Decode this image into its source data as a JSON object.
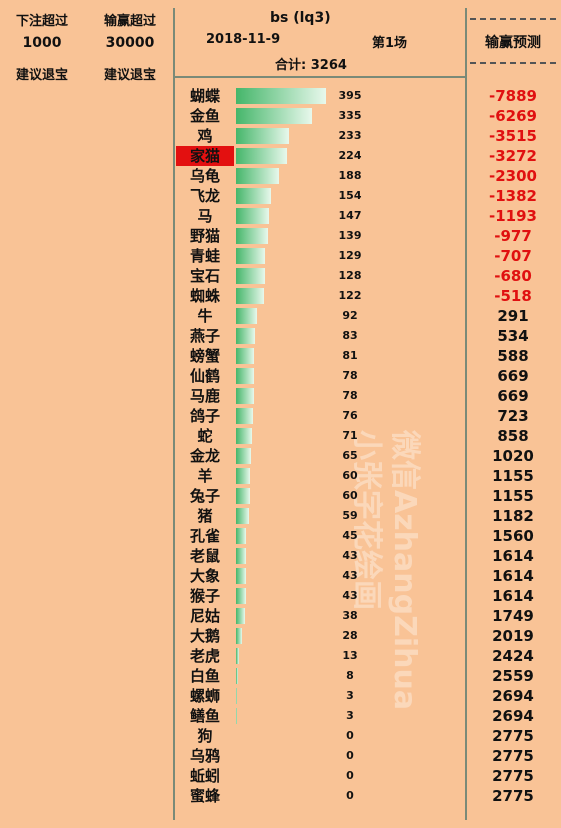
{
  "header": {
    "bet_over_label": "下注超过",
    "bet_over_value": "1000",
    "bet_over_advice": "建议退宝",
    "winloss_over_label": "输赢超过",
    "winloss_over_value": "30000",
    "winloss_over_advice": "建议退宝",
    "title": "bs (lq3)",
    "date": "2018-11-9",
    "round": "第1场",
    "total": "合计: 3264",
    "prediction_label": "输赢预测",
    "dashes": "----------"
  },
  "colors": {
    "background": "#f9c396",
    "highlight": "#e31010",
    "negative": "#e01010",
    "bar": "#45b66a"
  },
  "watermark": {
    "line1": "微信AzhangZihua",
    "line2": "小张字花绘画"
  },
  "chart_data": {
    "type": "bar",
    "orientation": "horizontal",
    "highlighted": "家猫",
    "categories": [
      "蝴蝶",
      "金鱼",
      "鸡",
      "家猫",
      "乌龟",
      "飞龙",
      "马",
      "野猫",
      "青蛙",
      "宝石",
      "蜘蛛",
      "牛",
      "燕子",
      "螃蟹",
      "仙鹤",
      "马鹿",
      "鸽子",
      "蛇",
      "金龙",
      "羊",
      "兔子",
      "猪",
      "孔雀",
      "老鼠",
      "大象",
      "猴子",
      "尼姑",
      "大鹅",
      "老虎",
      "白鱼",
      "螺蛳",
      "鳝鱼",
      "狗",
      "乌鸦",
      "蚯蚓",
      "蜜蜂"
    ],
    "values": [
      395,
      335,
      233,
      224,
      188,
      154,
      147,
      139,
      129,
      128,
      122,
      92,
      83,
      81,
      78,
      78,
      76,
      71,
      65,
      60,
      60,
      59,
      45,
      43,
      43,
      43,
      38,
      28,
      13,
      8,
      3,
      3,
      0,
      0,
      0,
      0
    ],
    "predictions": [
      "-7889",
      "-6269",
      "-3515",
      "-3272",
      "-2300",
      "-1382",
      "-1193",
      "-977",
      "-707",
      "-680",
      "-518",
      "291",
      "534",
      "588",
      "669",
      "669",
      "723",
      "858",
      "1020",
      "1155",
      "1155",
      "1182",
      "1560",
      "1614",
      "1614",
      "1614",
      "1749",
      "2019",
      "2424",
      "2559",
      "2694",
      "2694",
      "2775",
      "2775",
      "2775",
      "2775"
    ]
  }
}
